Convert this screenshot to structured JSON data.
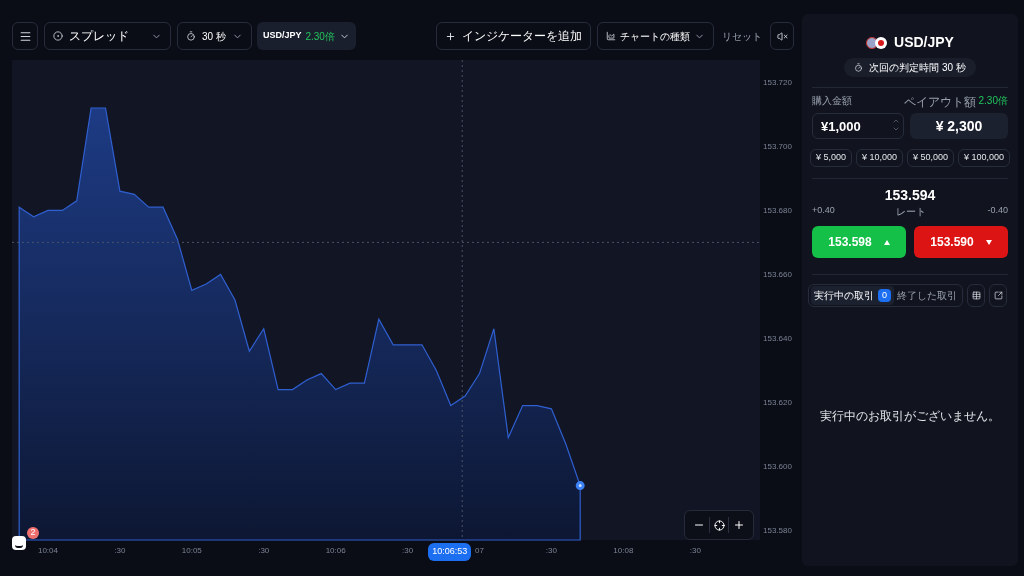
{
  "toolbar": {
    "spread": {
      "label": "スプレッド"
    },
    "timeframe": {
      "label": "30 秒"
    },
    "asset": {
      "label": "USD/JPY",
      "payout": "2.30倍"
    },
    "add_indicator": "インジケーターを追加",
    "chart_type": "チャートの種類",
    "reset": "リセット"
  },
  "chart": {
    "crosshair_time": "10:06:53",
    "chart_data": {
      "type": "area",
      "categories": [
        null,
        null,
        "10:04",
        null,
        null,
        null,
        null,
        ":30",
        null,
        null,
        null,
        null,
        "10:05",
        null,
        null,
        null,
        null,
        ":30",
        null,
        null,
        null,
        null,
        "10:06",
        null,
        null,
        null,
        null,
        ":30",
        null,
        null,
        null,
        null,
        "07",
        null,
        null,
        null,
        null,
        ":30",
        null,
        null,
        null,
        null,
        "10:08",
        null,
        null,
        null,
        null,
        ":30",
        null,
        null,
        null,
        null
      ],
      "series": [
        {
          "color": "#2f5fd0",
          "values": [
            153.681,
            153.678,
            153.68,
            153.68,
            153.683,
            153.712,
            153.712,
            153.686,
            153.685,
            153.681,
            153.681,
            153.671,
            153.655,
            153.657,
            153.66,
            153.652,
            153.636,
            153.643,
            153.624,
            153.624,
            153.627,
            153.629,
            153.624,
            153.626,
            153.626,
            153.646,
            153.638,
            153.638,
            153.638,
            153.63,
            153.619,
            153.622,
            153.629,
            153.643,
            153.609,
            153.619,
            153.619,
            153.618,
            153.607,
            153.594,
            null,
            null,
            null,
            null,
            null,
            null,
            null,
            null,
            null,
            null,
            null,
            null
          ]
        }
      ],
      "ylim": [
        153.577,
        153.727
      ],
      "yticks": [
        {
          "value": 153.72,
          "label": "153.720"
        },
        {
          "value": 153.7,
          "label": "153.700"
        },
        {
          "value": 153.68,
          "label": "153.680"
        },
        {
          "value": 153.66,
          "label": "153.660"
        },
        {
          "value": 153.64,
          "label": "153.640"
        },
        {
          "value": 153.62,
          "label": "153.620"
        },
        {
          "value": 153.6,
          "label": "153.600"
        },
        {
          "value": 153.58,
          "label": "153.580"
        }
      ]
    }
  },
  "chat": {
    "badge": "2"
  },
  "trade_panel": {
    "asset": "USD/JPY",
    "expiry": "次回の判定時間 30 秒",
    "amount": {
      "label": "購入金額",
      "value": "¥1,000"
    },
    "payout": {
      "label": "ペイアウト額",
      "multiplier": "2.30倍",
      "value": "¥ 2,300"
    },
    "presets": [
      "¥ 5,000",
      "¥ 10,000",
      "¥ 50,000",
      "¥ 100,000"
    ],
    "rate": {
      "value": "153.594",
      "label": "レート",
      "up_change": "+0.40",
      "down_change": "-0.40"
    },
    "buy_button": "153.598",
    "sell_button": "153.590",
    "tabs": [
      {
        "label": "実行中の取引",
        "count": "0",
        "selected": true
      },
      {
        "label": "終了した取引",
        "selected": false
      }
    ],
    "empty_message": "実行中のお取引がございません。"
  }
}
